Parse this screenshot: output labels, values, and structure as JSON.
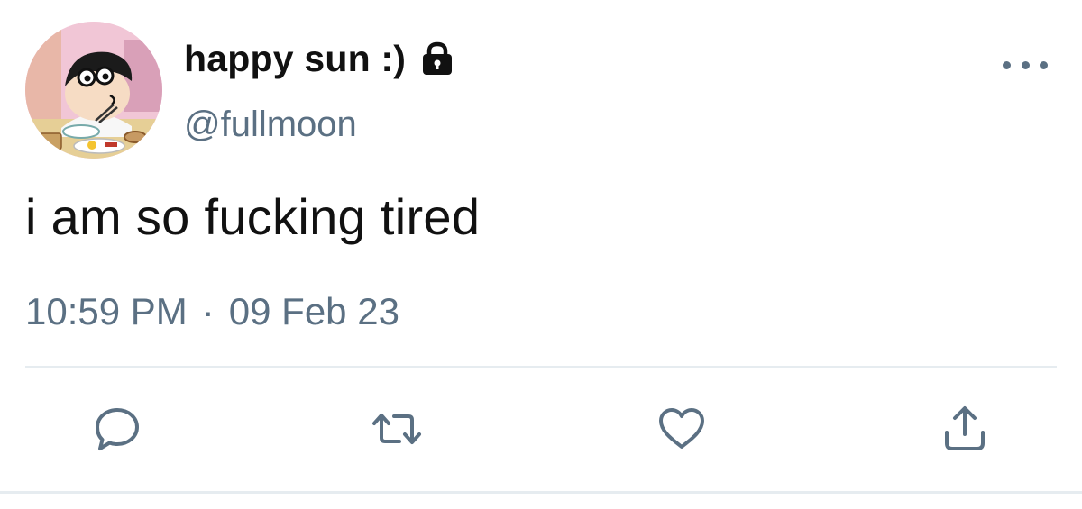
{
  "tweet": {
    "display_name": "happy sun :)",
    "handle": "@fullmoon",
    "text": "i am so fucking tired",
    "time": "10:59 PM",
    "separator": "·",
    "date": "09 Feb 23",
    "protected": true
  },
  "icons": {
    "lock": "lock-icon",
    "more": "more-icon",
    "reply": "reply-icon",
    "retweet": "retweet-icon",
    "like": "heart-icon",
    "share": "share-icon"
  },
  "colors": {
    "text": "#111111",
    "secondary": "#5b7083",
    "divider": "#e6ecf0",
    "background": "#ffffff"
  }
}
